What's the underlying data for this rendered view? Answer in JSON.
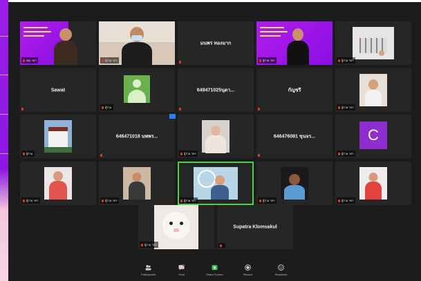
{
  "colors": {
    "window_bg": "#1c1c1c",
    "tile_bg": "#262626",
    "active_speaker": "#4ad34a",
    "muted": "#e2382b",
    "accent_purple": "#9a1fe6"
  },
  "participants": [
    {
      "kind": "video",
      "label": "คุณ ฯลฯ",
      "speaking": false
    },
    {
      "kind": "video",
      "label": "ผู้ร่วม ฯลฯ",
      "speaking": false
    },
    {
      "kind": "name",
      "name": "มนพร ทองมาก",
      "label": "",
      "speaking": false
    },
    {
      "kind": "video",
      "label": "ผู้ร่วม ฯลฯ",
      "speaking": false
    },
    {
      "kind": "video",
      "label": "ผู้ร่วม ฯลฯ",
      "speaking": false
    },
    {
      "kind": "name",
      "name": "Sawat",
      "label": "",
      "speaking": false
    },
    {
      "kind": "avatar",
      "label": "ผู้ร่วม",
      "speaking": false
    },
    {
      "kind": "name",
      "name": "649471025นุดา...",
      "label": "",
      "speaking": false
    },
    {
      "kind": "name",
      "name": "กัญชรี",
      "label": "",
      "speaking": false
    },
    {
      "kind": "video",
      "label": "ผู้ร่วม ฯลฯ",
      "speaking": false
    },
    {
      "kind": "video",
      "label": "ผู้ร่วม",
      "speaking": false
    },
    {
      "kind": "name",
      "name": "646471018 นพพร...",
      "label": "",
      "speaking": false,
      "badge": true
    },
    {
      "kind": "video",
      "label": "ผู้ร่วม ฯลฯ",
      "speaking": false
    },
    {
      "kind": "name",
      "name": "646476081 ขุนจร...",
      "label": "",
      "speaking": false
    },
    {
      "kind": "letter",
      "letter": "C",
      "label": "ผู้ร่วม ฯลฯ",
      "speaking": false
    },
    {
      "kind": "video",
      "label": "ผู้ร่วม ฯลฯ",
      "speaking": false
    },
    {
      "kind": "video",
      "label": "ผู้ร่วม ฯลฯ",
      "speaking": false
    },
    {
      "kind": "video",
      "label": "ผู้ร่วม ฯลฯ",
      "speaking": true
    },
    {
      "kind": "video",
      "label": "ผู้ร่วม ฯลฯ",
      "speaking": false
    },
    {
      "kind": "video",
      "label": "ผู้ร่วม ฯลฯ",
      "speaking": false
    },
    {
      "kind": "video",
      "label": "ผู้ร่วม ฯลฯ",
      "speaking": false
    },
    {
      "kind": "name",
      "name": "Supatra Klomsakul",
      "label": "",
      "speaking": false
    }
  ],
  "toolbar": [
    {
      "icon": "participants-icon",
      "label": "Participants"
    },
    {
      "icon": "chat-icon",
      "label": "Chat"
    },
    {
      "icon": "share-screen-icon",
      "label": "Share Screen"
    },
    {
      "icon": "record-icon",
      "label": "Record"
    },
    {
      "icon": "reactions-icon",
      "label": "Reactions"
    }
  ]
}
